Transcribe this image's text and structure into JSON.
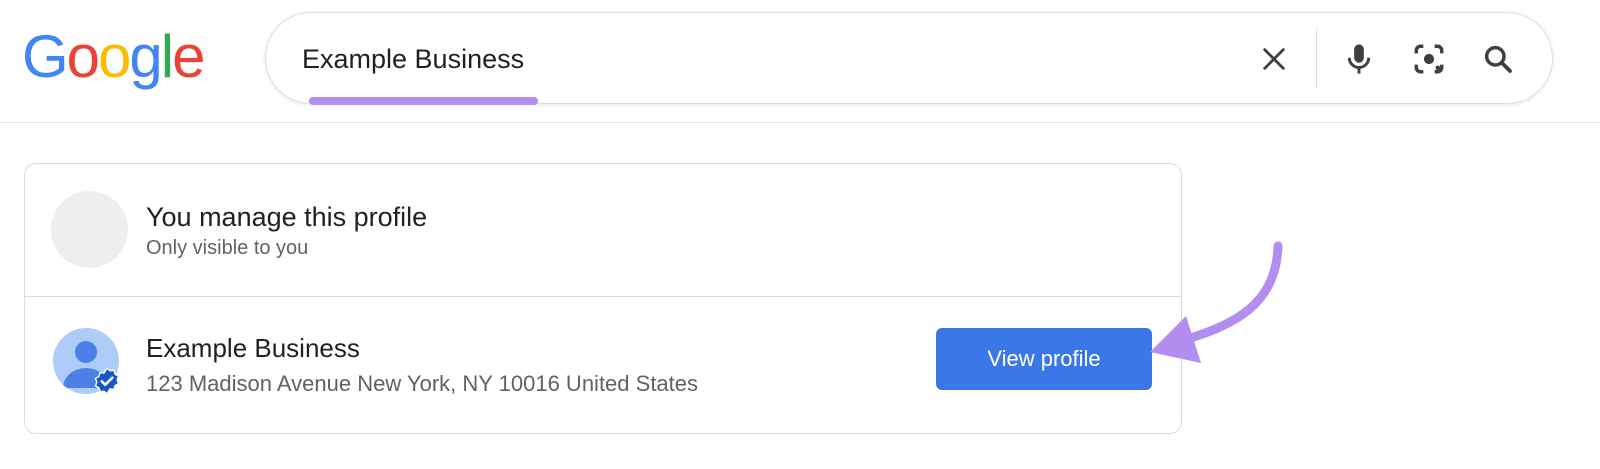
{
  "logo": {
    "letters": [
      "G",
      "o",
      "o",
      "g",
      "l",
      "e"
    ]
  },
  "search": {
    "query": "Example Business",
    "icons": [
      "close-icon",
      "microphone-icon",
      "camera-lens-icon",
      "search-icon"
    ],
    "highlight_color": "#b38df0"
  },
  "card": {
    "manage": {
      "title": "You manage this profile",
      "subtitle": "Only visible to you"
    },
    "business": {
      "name": "Example Business",
      "address": "123 Madison Avenue New York, NY 10016 United States",
      "view_button": "View profile",
      "avatar_icon": "person-icon",
      "badge_icon": "verified-icon"
    }
  },
  "colors": {
    "button": "#3b78e7",
    "annotation_arrow": "#b38df0",
    "google_blue": "#4285f4",
    "google_red": "#ea4335",
    "google_yellow": "#fbbc05",
    "google_green": "#34a853"
  }
}
